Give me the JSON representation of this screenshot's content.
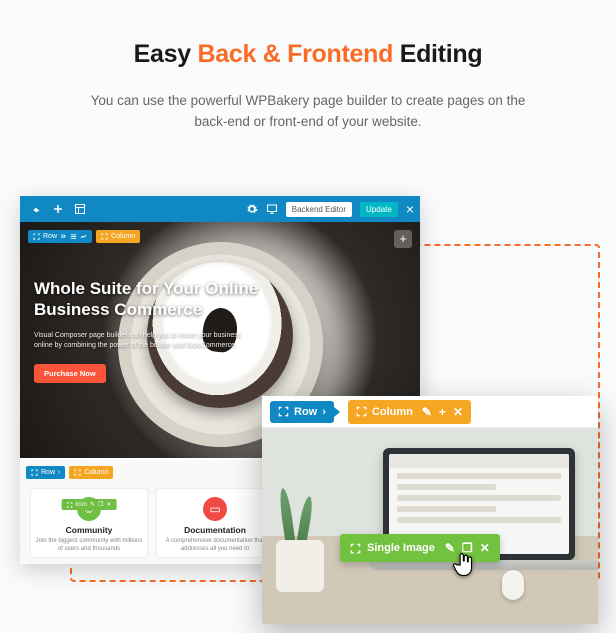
{
  "headline": {
    "pre": "Easy ",
    "accent": "Back & Frontend",
    "post": " Editing"
  },
  "subtitle": "You can use the powerful WPBakery page builder to create pages on the back-end or front-end of your website.",
  "editor": {
    "toolbar": {
      "backend_label": "Backend Editor",
      "update_label": "Update"
    },
    "hero": {
      "mini_row": "Row",
      "mini_col": "Column",
      "title": "Whole Suite for Your Online Business Commerce",
      "desc": "Visual Composer page builder can help you to move your business online by combining the power of the builder and WooCommerce.",
      "cta": "Purchase Now"
    },
    "cards": {
      "mini_row": "Row",
      "mini_col": "Column",
      "green_pill": "Icon",
      "items": [
        {
          "title": "Community",
          "desc": "Join the biggest community with millions of users and thousands"
        },
        {
          "title": "Documentation",
          "desc": "A comprehensive documentation that addresses all you need to"
        },
        {
          "title": "",
          "desc": ""
        }
      ]
    }
  },
  "panel": {
    "row_label": "Row",
    "col_label": "Column",
    "image_chip": "Single Image"
  }
}
